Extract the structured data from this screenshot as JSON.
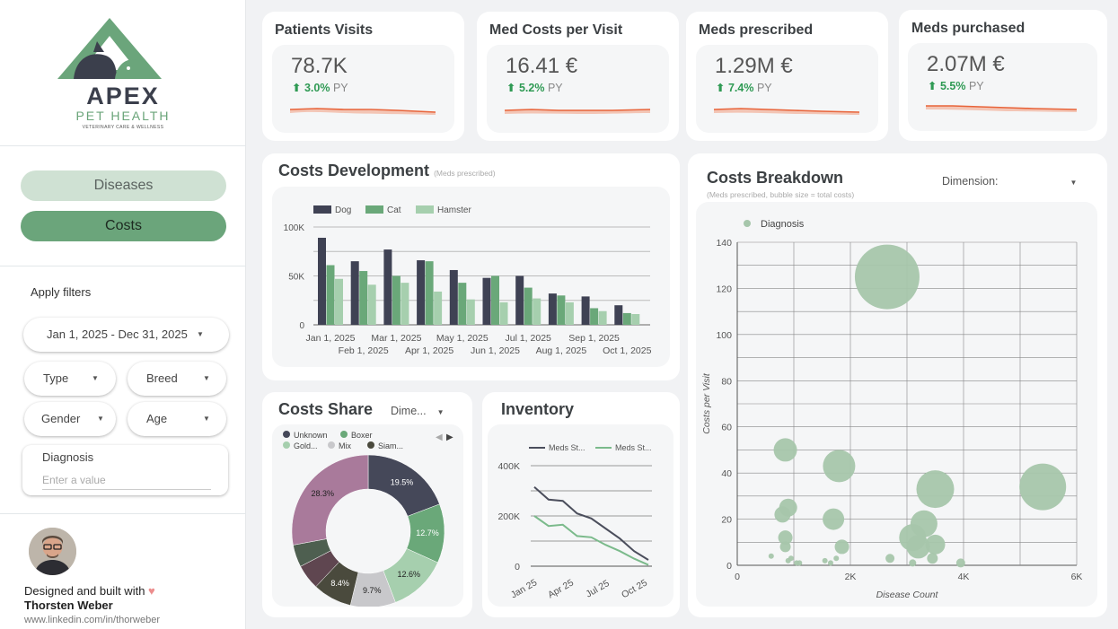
{
  "brand": {
    "name": "APEX",
    "sub": "PET HEALTH",
    "tagline": "VETERINARY CARE & WELLNESS"
  },
  "nav": {
    "diseases": "Diseases",
    "costs": "Costs"
  },
  "filters": {
    "apply_label": "Apply filters",
    "date_range": "Jan 1, 2025 - Dec 31, 2025",
    "type": "Type",
    "breed": "Breed",
    "gender": "Gender",
    "age": "Age",
    "diagnosis_label": "Diagnosis",
    "diagnosis_placeholder": "Enter a value"
  },
  "credit": {
    "line1": "Designed and built with",
    "name": "Thorsten Weber",
    "link": "www.linkedin.com/in/thorweber"
  },
  "kpis": [
    {
      "title": "Patients Visits",
      "value": "78.7K",
      "delta": "3.0%",
      "suffix": "PY"
    },
    {
      "title": "Med Costs per Visit",
      "value": "16.41 €",
      "delta": "5.2%",
      "suffix": "PY"
    },
    {
      "title": "Meds prescribed",
      "value": "1.29M €",
      "delta": "7.4%",
      "suffix": "PY"
    },
    {
      "title": "Meds purchased",
      "value": "2.07M €",
      "delta": "5.5%",
      "suffix": "PY"
    }
  ],
  "colors": {
    "accent": "#6ba57b",
    "dog": "#3f4254",
    "cat": "#6aa879",
    "hamster": "#a6cfae",
    "spark": "#e8643a",
    "bubble": "#a6c6ab",
    "up": "#2f9a54"
  },
  "costs_development": {
    "title": "Costs Development",
    "subtitle": "(Meds prescribed)"
  },
  "costs_share": {
    "title": "Costs Share",
    "dimension": "Dime..."
  },
  "inventory": {
    "title": "Inventory"
  },
  "costs_breakdown": {
    "title": "Costs Breakdown",
    "subtitle": "(Meds prescribed, bubble size = total costs)",
    "dimension": "Dimension:"
  },
  "chart_data": [
    {
      "type": "bar",
      "categories": [
        "Jan 1, 2025",
        "Feb 1, 2025",
        "Mar 1, 2025",
        "Apr 1, 2025",
        "May 1, 2025",
        "Jun 1, 2025",
        "Jul 1, 2025",
        "Aug 1, 2025",
        "Sep 1, 2025",
        "Oct 1, 2025"
      ],
      "series": [
        {
          "name": "Dog",
          "values": [
            89000,
            65000,
            77000,
            66000,
            56000,
            48000,
            50000,
            32000,
            29000,
            20000
          ]
        },
        {
          "name": "Cat",
          "values": [
            61000,
            55000,
            50000,
            65000,
            43000,
            50000,
            38000,
            30000,
            17000,
            12000
          ]
        },
        {
          "name": "Hamster",
          "values": [
            47000,
            41000,
            43000,
            34000,
            26000,
            23000,
            27000,
            23000,
            14000,
            11000
          ]
        }
      ],
      "yticks": [
        "0",
        "50K",
        "100K"
      ],
      "ylim": [
        0,
        100000
      ],
      "legend": "top-left"
    },
    {
      "type": "pie",
      "legend": [
        "Unknown",
        "Boxer",
        "Gold...",
        "Mix",
        "Siam..."
      ],
      "slices": [
        {
          "value": 19.5,
          "label": "19.5%",
          "color": "#454859"
        },
        {
          "value": 12.7,
          "label": "12.7%",
          "color": "#6aa879"
        },
        {
          "value": 12.6,
          "label": "12.6%",
          "color": "#a6cfae"
        },
        {
          "value": 9.7,
          "label": "9.7%",
          "color": "#c8c8cb"
        },
        {
          "value": 8.4,
          "label": "8.4%",
          "color": "#4a4a3d"
        },
        {
          "value": 5.4,
          "label": "",
          "color": "#5f4650"
        },
        {
          "value": 4.8,
          "label": "",
          "color": "#4e5f50"
        },
        {
          "value": 28.3,
          "label": "28.3%",
          "color": "#a97a9b"
        }
      ]
    },
    {
      "type": "line",
      "x": [
        "Jan 25",
        "Apr 25",
        "Jul 25",
        "Oct 25"
      ],
      "series": [
        {
          "name": "Meds St...",
          "color": "#4b4e5c",
          "values": [
            315000,
            265000,
            260000,
            210000,
            190000,
            150000,
            110000,
            60000,
            25000
          ]
        },
        {
          "name": "Meds St...",
          "color": "#7bba8b",
          "values": [
            200000,
            160000,
            165000,
            120000,
            115000,
            85000,
            60000,
            30000,
            5000
          ]
        }
      ],
      "yticks": [
        "0",
        "200K",
        "400K"
      ],
      "ylim": [
        0,
        400000
      ]
    },
    {
      "type": "scatter",
      "legend": [
        "Diagnosis"
      ],
      "xlabel": "Disease Count",
      "ylabel": "Costs per Visit",
      "xlim": [
        0,
        6000
      ],
      "ylim": [
        0,
        140
      ],
      "xticks": [
        "0",
        "2K",
        "4K",
        "6K"
      ],
      "yticks": [
        "0",
        "20",
        "40",
        "60",
        "80",
        "100",
        "120",
        "140"
      ],
      "points": [
        {
          "x": 2650,
          "y": 125,
          "s": 36
        },
        {
          "x": 5400,
          "y": 34,
          "s": 26
        },
        {
          "x": 3500,
          "y": 33,
          "s": 21
        },
        {
          "x": 3300,
          "y": 18,
          "s": 15
        },
        {
          "x": 3100,
          "y": 12,
          "s": 15
        },
        {
          "x": 3200,
          "y": 8,
          "s": 13
        },
        {
          "x": 3500,
          "y": 9,
          "s": 11
        },
        {
          "x": 1800,
          "y": 43,
          "s": 18
        },
        {
          "x": 850,
          "y": 50,
          "s": 13
        },
        {
          "x": 900,
          "y": 25,
          "s": 10
        },
        {
          "x": 800,
          "y": 22,
          "s": 9
        },
        {
          "x": 1700,
          "y": 20,
          "s": 12
        },
        {
          "x": 850,
          "y": 12,
          "s": 8
        },
        {
          "x": 850,
          "y": 8,
          "s": 6
        },
        {
          "x": 1850,
          "y": 8,
          "s": 8
        },
        {
          "x": 600,
          "y": 4,
          "s": 3
        },
        {
          "x": 900,
          "y": 2,
          "s": 3
        },
        {
          "x": 950,
          "y": 3,
          "s": 3
        },
        {
          "x": 1050,
          "y": 1,
          "s": 3
        },
        {
          "x": 1100,
          "y": 1,
          "s": 3
        },
        {
          "x": 1550,
          "y": 2,
          "s": 3
        },
        {
          "x": 1650,
          "y": 1,
          "s": 3
        },
        {
          "x": 1750,
          "y": 3,
          "s": 3
        },
        {
          "x": 2700,
          "y": 3,
          "s": 5
        },
        {
          "x": 3100,
          "y": 1,
          "s": 4
        },
        {
          "x": 3450,
          "y": 3,
          "s": 6
        },
        {
          "x": 3950,
          "y": 1,
          "s": 5
        }
      ]
    }
  ]
}
